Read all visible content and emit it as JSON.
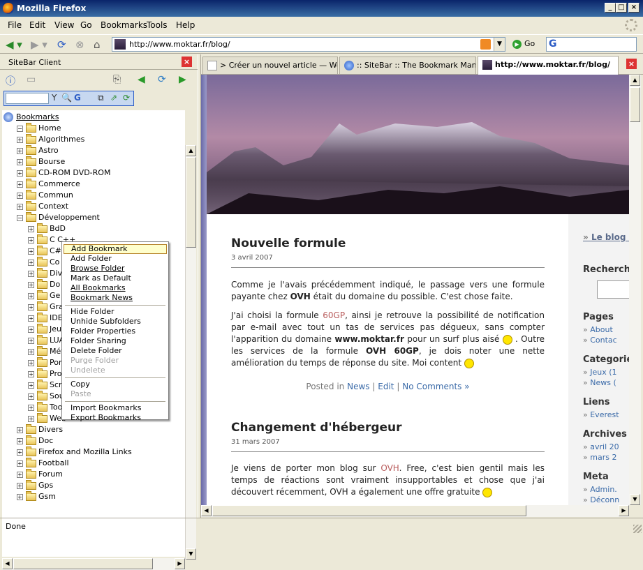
{
  "window": {
    "title": "Mozilla Firefox"
  },
  "menubar": {
    "items": [
      "File",
      "Edit",
      "View",
      "Go",
      "Bookmarks",
      "Tools",
      "Help"
    ]
  },
  "navbar": {
    "url": "http://www.moktar.fr/blog/",
    "go_label": "Go"
  },
  "sidebar": {
    "title": "SiteBar Client",
    "root_label": "Bookmarks",
    "tree": [
      {
        "label": "Home",
        "expanded": true
      },
      {
        "label": "Algorithmes"
      },
      {
        "label": "Astro"
      },
      {
        "label": "Bourse"
      },
      {
        "label": "CD-ROM DVD-ROM"
      },
      {
        "label": "Commerce"
      },
      {
        "label": "Commun"
      },
      {
        "label": "Context"
      },
      {
        "label": "Développement",
        "expanded": true
      },
      {
        "label": "BdD"
      },
      {
        "label": "C C++"
      },
      {
        "label": "C#"
      },
      {
        "label": "Co"
      },
      {
        "label": "Div"
      },
      {
        "label": "Do"
      },
      {
        "label": "Ge"
      },
      {
        "label": "Gra"
      },
      {
        "label": "IDE"
      },
      {
        "label": "Jeu"
      },
      {
        "label": "LUA"
      },
      {
        "label": "Mét"
      },
      {
        "label": "Por"
      },
      {
        "label": "Pro"
      },
      {
        "label": "Scr"
      },
      {
        "label": "Sou"
      },
      {
        "label": "Too"
      },
      {
        "label": "Web"
      },
      {
        "label": "Divers"
      },
      {
        "label": "Doc"
      },
      {
        "label": "Firefox and Mozilla Links"
      },
      {
        "label": "Football"
      },
      {
        "label": "Forum"
      },
      {
        "label": "Gps"
      },
      {
        "label": "Gsm"
      }
    ]
  },
  "context_menu": {
    "items": [
      {
        "label": "Add Bookmark",
        "highlighted": true
      },
      {
        "label": "Add Folder"
      },
      {
        "label": "Browse Folder",
        "underline": true
      },
      {
        "label": "Mark as Default"
      },
      {
        "label": "All Bookmarks",
        "underline": true
      },
      {
        "label": "Bookmark News",
        "underline": true
      },
      {
        "separator": true
      },
      {
        "label": "Hide Folder"
      },
      {
        "label": "Unhide Subfolders"
      },
      {
        "label": "Folder Properties"
      },
      {
        "label": "Folder Sharing"
      },
      {
        "label": "Delete Folder"
      },
      {
        "label": "Purge Folder",
        "disabled": true
      },
      {
        "label": "Undelete",
        "disabled": true
      },
      {
        "separator": true
      },
      {
        "label": "Copy"
      },
      {
        "label": "Paste",
        "disabled": true
      },
      {
        "separator": true
      },
      {
        "label": "Import Bookmarks"
      },
      {
        "label": "Export Bookmarks"
      }
    ]
  },
  "tabs": [
    {
      "label": "> Créer un nouvel article — Wor..."
    },
    {
      "label": ":: SiteBar :: The Bookmark Mana..."
    },
    {
      "label": "http://www.moktar.fr/blog/",
      "active": true
    }
  ],
  "posts": [
    {
      "title": "Nouvelle formule",
      "date": "3 avril 2007",
      "p1_a": "Comme je l'avais précédemment indiqué, le passage vers une formule payante chez ",
      "p1_b": "OVH",
      "p1_c": " était du domaine du possible. C'est chose faite.",
      "p2_a": "J'ai choisi la formule ",
      "p2_link": "60GP",
      "p2_b": ", ainsi je retrouve la possibilité de notification par e-mail avec tout un tas de services pas dégueux, sans compter l'apparition du domaine ",
      "p2_bold1": "www.moktar.fr",
      "p2_c": " pour un surf plus aisé ",
      "p2_d": " . Outre les services de la formule ",
      "p2_bold2": "OVH 60GP",
      "p2_e": ", je dois noter une nette amélioration du temps de réponse du site. Moi content ",
      "meta_prefix": "Posted in",
      "meta_cat": "News",
      "meta_edit": "Edit",
      "meta_comments": "No Comments »",
      "meta_sep": "|"
    },
    {
      "title": "Changement d'hébergeur",
      "date": "31 mars 2007",
      "p1_a": "Je viens de porter mon blog sur ",
      "p1_link": "OVH",
      "p1_b": ". Free, c'est bien gentil mais les temps de réactions sont vraiment insupportables et chose que j'ai découvert récemment, OVH a également une offre gratuite "
    }
  ],
  "blog_sidebar": {
    "blog_link": "Le blog d",
    "search_heading": "Recherch",
    "pages_heading": "Pages",
    "pages": [
      "About",
      "Contac"
    ],
    "categories_heading": "Categorie",
    "categories": [
      "Jeux (1",
      "News ("
    ],
    "links_heading": "Liens",
    "links": [
      "Everest"
    ],
    "archives_heading": "Archives",
    "archives": [
      "avril 20",
      "mars 2"
    ],
    "meta_heading": "Meta",
    "meta": [
      "Admin.",
      "Déconn"
    ]
  },
  "status": {
    "text": "Done"
  }
}
